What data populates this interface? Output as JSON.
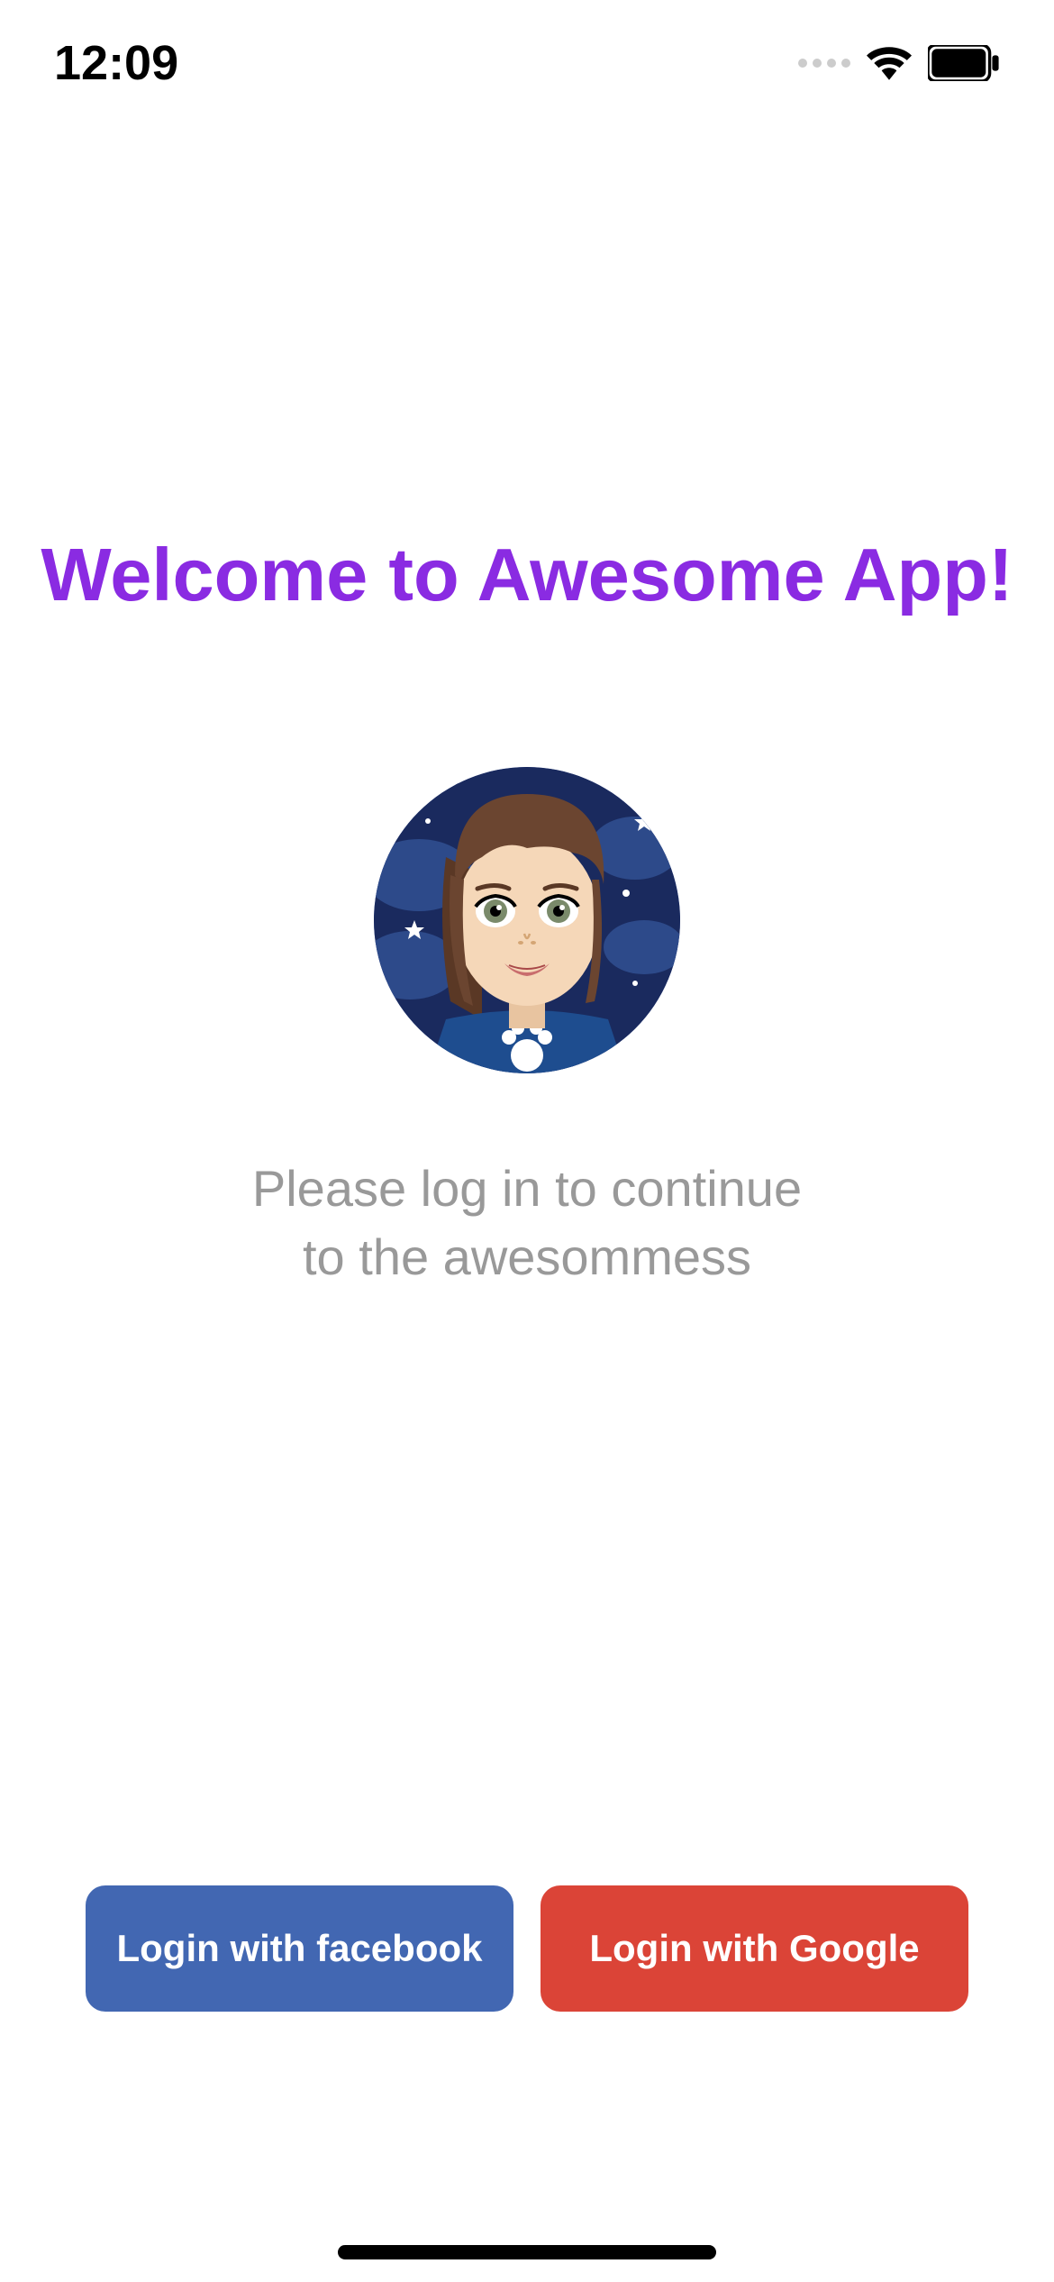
{
  "status": {
    "time": "12:09"
  },
  "title": "Welcome to Awesome App!",
  "subtitle_line1": "Please log in to continue",
  "subtitle_line2": "to the awesommess",
  "buttons": {
    "facebook_label": "Login with facebook",
    "google_label": "Login with Google"
  }
}
